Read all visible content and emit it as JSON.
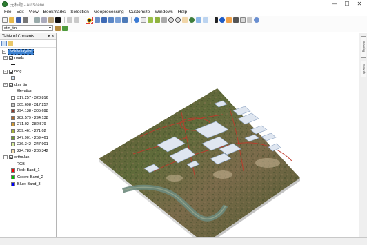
{
  "window": {
    "title": "无标题 - ArcScene",
    "controls": [
      "—",
      "☐",
      "✕"
    ]
  },
  "menu": [
    "File",
    "Edit",
    "View",
    "Bookmarks",
    "Selection",
    "Geoprocessing",
    "Customize",
    "Windows",
    "Help"
  ],
  "toolbar": {
    "layer_dropdown": "dtm_tin"
  },
  "toc": {
    "title": "Table of Contents",
    "pin_controls": "▾ ✕",
    "root": "Scene layers",
    "layers": [
      {
        "name": "roads"
      },
      {
        "name": "bldg"
      },
      {
        "name": "dtm_tin",
        "field": "Elevation",
        "classes": [
          {
            "label": "317.257 - 328.816",
            "color": "#ffffff"
          },
          {
            "label": "305.698 - 317.257",
            "color": "#c9c9c9"
          },
          {
            "label": "294.138 - 305.698",
            "color": "#8c3a2b"
          },
          {
            "label": "282.579 - 294.138",
            "color": "#b0692c"
          },
          {
            "label": "271.02 - 282.579",
            "color": "#d29a34"
          },
          {
            "label": "259.461 - 271.02",
            "color": "#a9b33c"
          },
          {
            "label": "247.901 - 259.461",
            "color": "#6e9e2d"
          },
          {
            "label": "236.342 - 247.901",
            "color": "#d6ed9a"
          },
          {
            "label": "224.783 - 236.342",
            "color": "#f5dfae"
          }
        ]
      },
      {
        "name": "ortho.lan",
        "field": "RGB",
        "bands": [
          {
            "label": "Red:",
            "band": "Band_1",
            "color": "#ff0000"
          },
          {
            "label": "Green:",
            "band": "Band_2",
            "color": "#00c000"
          },
          {
            "label": "Blue:",
            "band": "Band_3",
            "color": "#0000ff"
          }
        ]
      }
    ]
  },
  "side_tabs": [
    "Catalog",
    "Search"
  ]
}
